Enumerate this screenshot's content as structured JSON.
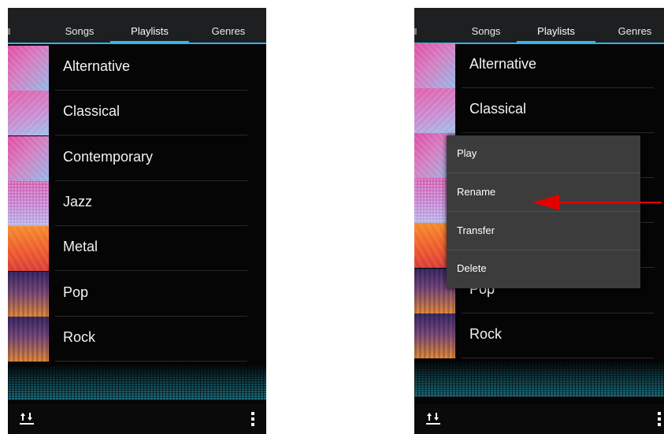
{
  "tabs": [
    "Songs",
    "Playlists",
    "Genres"
  ],
  "active_tab": "Playlists",
  "playlists": [
    {
      "name": "Alternative",
      "art": "pink-gradient-art"
    },
    {
      "name": "Classical",
      "art": "pink-gradient-art"
    },
    {
      "name": "Contemporary",
      "art": "pink-gradient-art"
    },
    {
      "name": "Jazz",
      "art": "pink-dots-art"
    },
    {
      "name": "Metal",
      "art": "orange-art"
    },
    {
      "name": "Pop",
      "art": "sunset-art"
    },
    {
      "name": "Rock",
      "art": "sunset-art"
    }
  ],
  "context_menu": {
    "items": [
      "Play",
      "Rename",
      "Transfer",
      "Delete"
    ],
    "highlighted": "Rename"
  },
  "bottom_bar": {
    "left_icon": "shuffle-icon",
    "right_icon": "overflow-menu-icon"
  },
  "colors": {
    "accent": "#33b5e5",
    "tab_bar": "#1e1f21",
    "background": "#050505",
    "menu_background": "#3c3c3d",
    "annotation_arrow": "#e50000"
  }
}
